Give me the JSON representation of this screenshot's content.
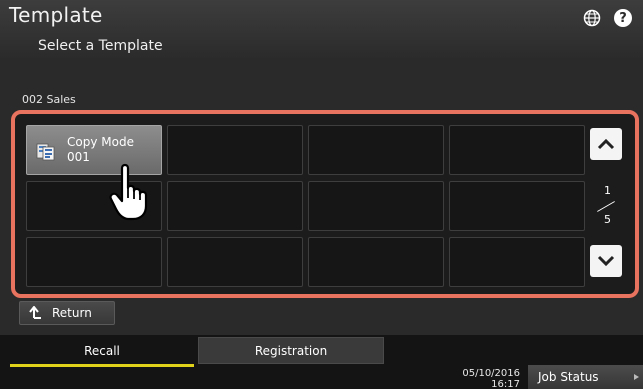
{
  "header": {
    "title": "Template",
    "subtitle": "Select a Template"
  },
  "group": {
    "label": "002 Sales"
  },
  "grid": {
    "templates": [
      {
        "name": "Copy Mode",
        "number": "001"
      }
    ]
  },
  "pagination": {
    "current": "1",
    "total": "5"
  },
  "buttons": {
    "return_label": "Return"
  },
  "tabs": {
    "recall": "Recall",
    "registration": "Registration"
  },
  "status": {
    "date": "05/10/2016",
    "time": "16:17",
    "job_status": "Job Status"
  },
  "colors": {
    "highlight": "#e8735f",
    "active_tab": "#e0d21a"
  },
  "icons": [
    "globe-icon",
    "help-icon",
    "copy-template-icon",
    "chevron-up-icon",
    "chevron-down-icon",
    "return-arrow-icon",
    "pointing-hand-icon"
  ]
}
